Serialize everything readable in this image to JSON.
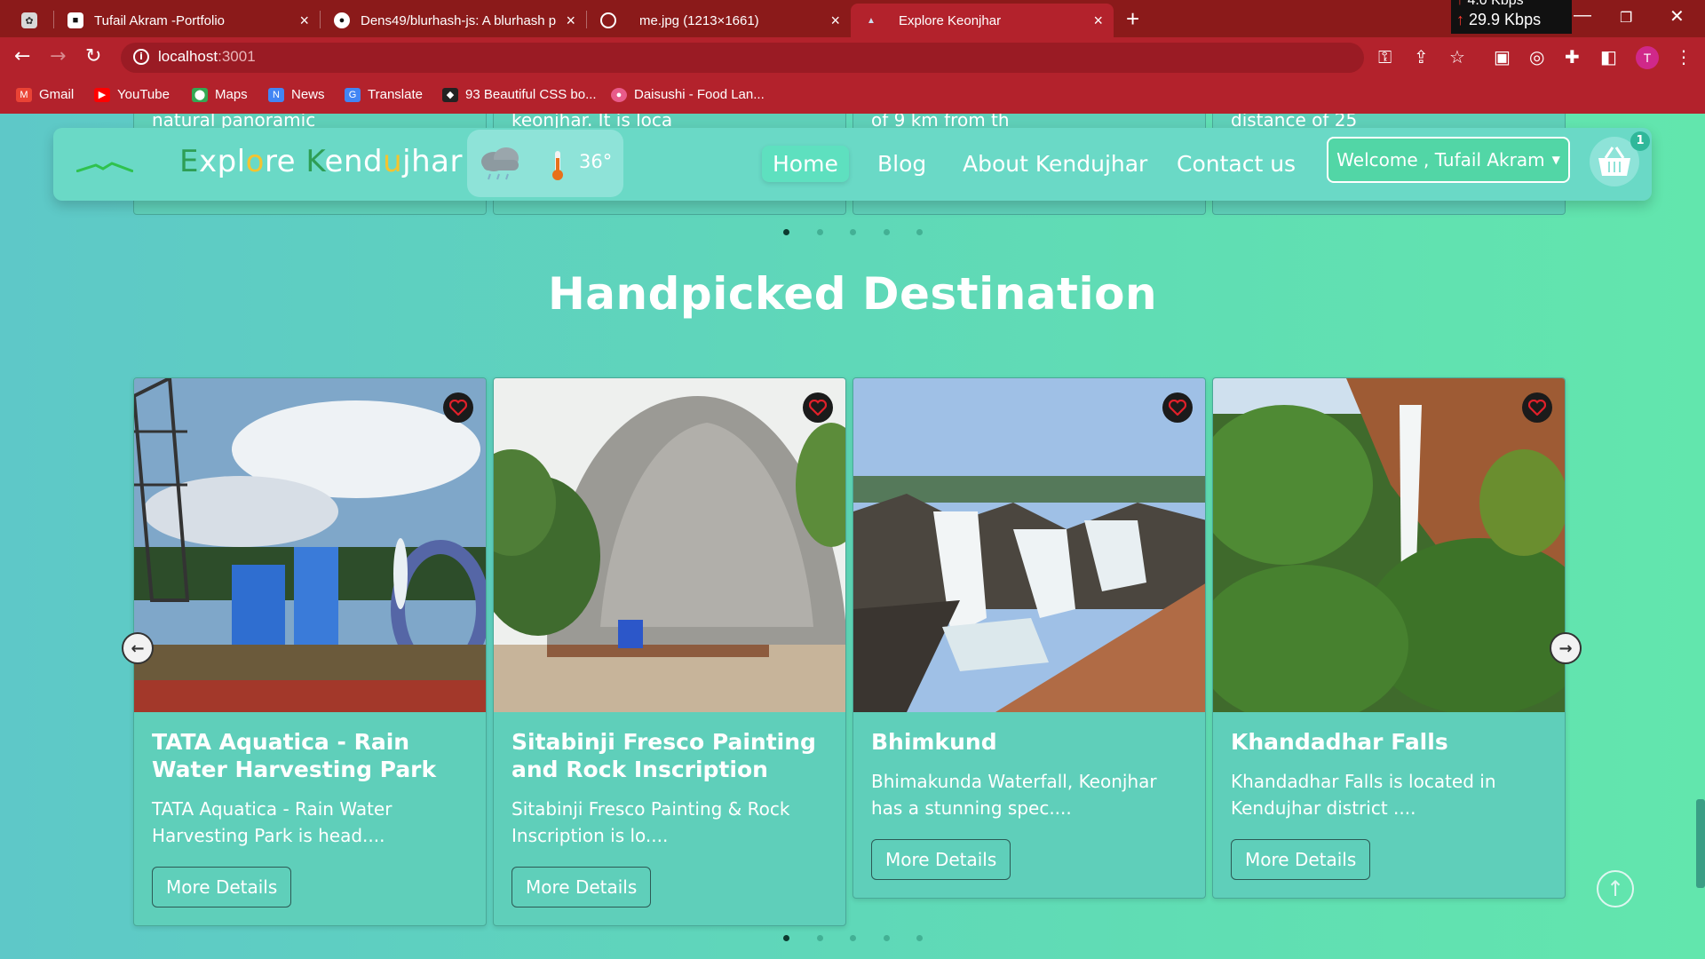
{
  "browser": {
    "tabs": [
      {
        "title": "",
        "icon": "gpt-icon"
      },
      {
        "title": "Tufail Akram -Portfolio",
        "icon": "portfolio-icon"
      },
      {
        "title": "Dens49/blurhash-js: A blurhash p",
        "icon": "github-icon"
      },
      {
        "title": "me.jpg (1213×1661)",
        "icon": "globe-icon"
      },
      {
        "title": "Explore Keonjhar",
        "icon": "site-icon"
      }
    ],
    "new_tab_label": "+",
    "net_speed_up": "4.0 Kbps",
    "net_speed_down": "29.9 Kbps",
    "url_host": "localhost",
    "url_port": ":3001",
    "profile_initial": "T",
    "bookmarks": [
      {
        "label": "Gmail",
        "color": "#ea4335"
      },
      {
        "label": "YouTube",
        "color": "#ff0000"
      },
      {
        "label": "Maps",
        "color": "#34a853"
      },
      {
        "label": "News",
        "color": "#4285f4"
      },
      {
        "label": "Translate",
        "color": "#4285f4"
      },
      {
        "label": "93 Beautiful CSS bo...",
        "color": "#222222"
      },
      {
        "label": "Daisushi - Food Lan...",
        "color": "#e85b8a"
      }
    ]
  },
  "top_cards": [
    {
      "snippet": "natural panoramic"
    },
    {
      "snippet": "keonjhar. It is loca"
    },
    {
      "snippet": "of 9 km from th"
    },
    {
      "snippet": "distance of 25"
    }
  ],
  "navbar": {
    "brand_parts": [
      {
        "text": "E",
        "color": "#2e9e55"
      },
      {
        "text": "xpl",
        "color": "#ffffff"
      },
      {
        "text": "o",
        "color": "#f4c430"
      },
      {
        "text": "re ",
        "color": "#ffffff"
      },
      {
        "text": "K",
        "color": "#2e9e55"
      },
      {
        "text": "end",
        "color": "#ffffff"
      },
      {
        "text": "u",
        "color": "#f4c430"
      },
      {
        "text": "jhar",
        "color": "#ffffff"
      }
    ],
    "temperature": "36°",
    "links": [
      {
        "label": "Home",
        "active": true
      },
      {
        "label": "Blog",
        "active": false
      },
      {
        "label": "About Kendujhar",
        "active": false
      },
      {
        "label": "Contact us",
        "active": false
      }
    ],
    "welcome_label": "Welcome , Tufail Akram",
    "cart_count": "1"
  },
  "section": {
    "title": "Handpicked Destination"
  },
  "destinations": [
    {
      "title": "TATA Aquatica - Rain Water Harvesting Park",
      "description": "TATA Aquatica - Rain Water Harvesting Park is head....",
      "button": "More Details"
    },
    {
      "title": "Sitabinji Fresco Painting and Rock Inscription",
      "description": "Sitabinji Fresco Painting & Rock Inscription is lo....",
      "button": "More Details"
    },
    {
      "title": "Bhimkund",
      "description": "Bhimakunda Waterfall, Keonjhar has a stunning spec....",
      "button": "More Details"
    },
    {
      "title": "Khandadhar Falls",
      "description": "Khandadhar Falls is located in Kendujhar district ....",
      "button": "More Details"
    }
  ],
  "carousel": {
    "dot_count": 5,
    "active_dot": 0
  },
  "colors": {
    "browser_frame": "#b3222c",
    "accent": "#5ed6b4"
  }
}
